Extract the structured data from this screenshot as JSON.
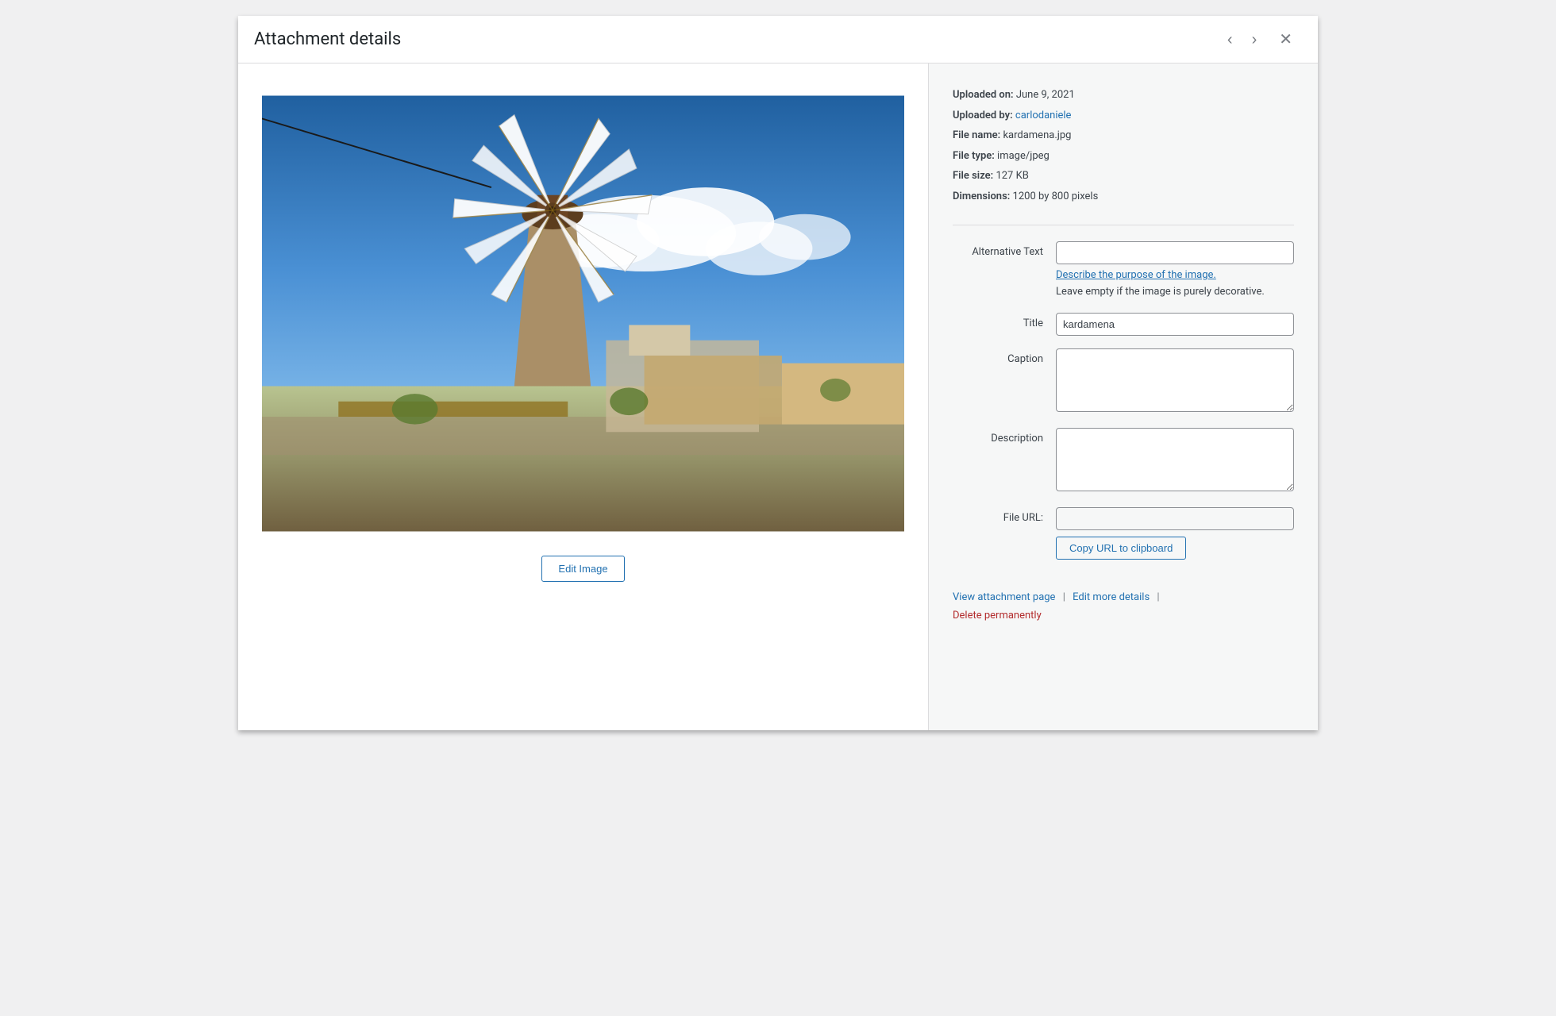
{
  "header": {
    "title": "Attachment details",
    "prev_label": "‹",
    "next_label": "›",
    "close_label": "✕"
  },
  "file_info": {
    "uploaded_on_label": "Uploaded on:",
    "uploaded_on_value": "June 9, 2021",
    "uploaded_by_label": "Uploaded by:",
    "uploaded_by_value": "carlodaniele",
    "uploaded_by_href": "#",
    "file_name_label": "File name:",
    "file_name_value": "kardamena.jpg",
    "file_type_label": "File type:",
    "file_type_value": "image/jpeg",
    "file_size_label": "File size:",
    "file_size_value": "127 KB",
    "dimensions_label": "Dimensions:",
    "dimensions_value": "1200 by 800 pixels"
  },
  "form": {
    "alt_text_label": "Alternative Text",
    "alt_text_value": "",
    "describe_link": "Describe the purpose of the image.",
    "describe_hint": "Leave empty if the image is purely decorative.",
    "title_label": "Title",
    "title_value": "kardamena",
    "caption_label": "Caption",
    "caption_value": "",
    "description_label": "Description",
    "description_value": "",
    "file_url_label": "File URL:",
    "file_url_value": ""
  },
  "buttons": {
    "edit_image": "Edit Image",
    "copy_url": "Copy URL to clipboard"
  },
  "footer": {
    "view_attachment": "View attachment page",
    "separator1": "|",
    "edit_more": "Edit more details",
    "separator2": "|",
    "delete": "Delete permanently"
  }
}
